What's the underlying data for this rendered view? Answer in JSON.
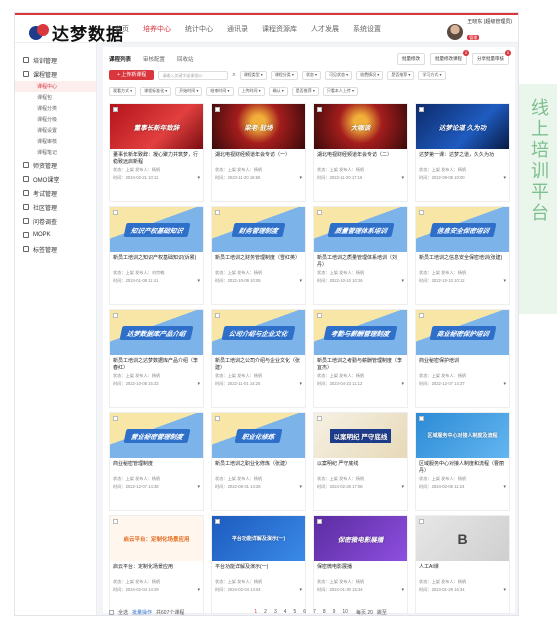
{
  "app": {
    "brand": "达梦数据"
  },
  "topnav": [
    {
      "label": "首页",
      "active": false
    },
    {
      "label": "培养中心",
      "active": true
    },
    {
      "label": "统计中心",
      "active": false
    },
    {
      "label": "通讯录",
      "active": false
    },
    {
      "label": "课程资源库",
      "active": false
    },
    {
      "label": "人才发展",
      "active": false
    },
    {
      "label": "系统设置",
      "active": false
    }
  ],
  "user": {
    "name": "王晓东 (超级管理员)",
    "tag": "管理"
  },
  "sidebar": {
    "items": [
      {
        "label": "培训管理"
      },
      {
        "label": "课程管理"
      },
      {
        "label": "师资管理"
      },
      {
        "label": "OMO课堂"
      },
      {
        "label": "考试管理"
      },
      {
        "label": "社区管理"
      },
      {
        "label": "问卷调查"
      },
      {
        "label": "MOPK"
      },
      {
        "label": "标签管理"
      }
    ],
    "sub": [
      {
        "label": "课程中心",
        "active": true
      },
      {
        "label": "课程包",
        "active": false
      },
      {
        "label": "课程分类",
        "active": false
      },
      {
        "label": "课程分级",
        "active": false
      },
      {
        "label": "课程设置",
        "active": false
      },
      {
        "label": "课程审核",
        "active": false
      },
      {
        "label": "课程笔记",
        "active": false
      }
    ]
  },
  "crumbs": [
    "课程列表",
    "审核配置",
    "回收站"
  ],
  "right_tabs": [
    {
      "label": "批量修改",
      "badge": ""
    },
    {
      "label": "批量修改课程",
      "badge": "0"
    },
    {
      "label": "分享批量审核",
      "badge": "0"
    }
  ],
  "filters1": {
    "add": "+ 上传新课程",
    "search_placeholder": "请输入关键字或课程ID",
    "selects": [
      "课程类型",
      "课程分类",
      "状态",
      "可见状态",
      "收费情况",
      "是否推荐",
      "学习方式"
    ]
  },
  "filters2": {
    "selects": [
      "观看方式",
      "课程标准化",
      "开始时间",
      "结束时间",
      "上传时间",
      "确认",
      "是否推荐",
      "只看本人上传"
    ]
  },
  "cards": [
    {
      "thumb": "t-red",
      "cap": "董事长新年致辞",
      "title": "董事长新年致辞：凝心聚力共筑梦，行稳致远启新程",
      "state": "状态：上架  发布人：杨帆",
      "time": "时间：2024-02-21 10:11"
    },
    {
      "thumb": "t-stage",
      "cap": "梁老·驻场",
      "title": "湖北电视财经频道年会专访（一）",
      "state": "状态：上架  发布人：杨帆",
      "time": "时间：2023-11-20 16:56"
    },
    {
      "thumb": "t-stage",
      "cap": "大咖谈",
      "title": "湖北电视财经频道年会专访（二）",
      "state": "状态：上架  发布人：杨帆",
      "time": "时间：2023-11-20 17:16"
    },
    {
      "thumb": "t-blue",
      "cap": "达梦论道 久为功",
      "title": "达梦第一课：达梦之道，久久为功",
      "state": "状态：上架  发布人：杨帆",
      "time": "时间：2022-09-08 10:00"
    },
    {
      "thumb": "t-edu",
      "cap": "知识产权基础知识",
      "title": "新员工培训之知识产权基础知识(诉累)",
      "state": "状态：上架  发布人：刘宗翰",
      "time": "时间：2024-01-08 11:41"
    },
    {
      "thumb": "t-edu",
      "cap": "财务管理制度",
      "title": "新员工培训之财务管理制度（雪红英）",
      "state": "状态：上架  发布人：杨帆",
      "time": "时间：2022-10-09 10:05"
    },
    {
      "thumb": "t-edu",
      "cap": "质量管理体系培训",
      "title": "新员工培训之质量管理体系培训（刘丹）",
      "state": "状态：上架  发布人：杨帆",
      "time": "时间：2022-10-10 10:26"
    },
    {
      "thumb": "t-edu",
      "cap": "信息安全保密培训",
      "title": "新员工培训之信息安全保密培训(张建)",
      "state": "状态：上架  发布人：杨帆",
      "time": "时间：2022-10-10 10:12"
    },
    {
      "thumb": "t-edu",
      "cap": "达梦数据库产品介绍",
      "title": "新员工培训之达梦数据库产品介绍（李春红）",
      "state": "状态：上架  发布人：杨帆",
      "time": "时间：2022-10-08 15:33"
    },
    {
      "thumb": "t-edu",
      "cap": "公司介绍与企业文化",
      "title": "新员工培训之公司介绍与企业文化（张建）",
      "state": "状态：上架  发布人：杨帆",
      "time": "时间：2022-11-01 14:20"
    },
    {
      "thumb": "t-edu",
      "cap": "考勤与薪酬管理制度",
      "title": "新员工培训之考勤与薪酬管理制度（李宜杰）",
      "state": "状态：上架  发布人：杨帆",
      "time": "时间：2023-04-23 11:12"
    },
    {
      "thumb": "t-edu",
      "cap": "商业秘密保护培训",
      "title": "商业秘密保护培训",
      "state": "状态：上架  发布人：杨帆",
      "time": "时间：2022-12-07 14:37"
    },
    {
      "thumb": "t-edu",
      "cap": "营业秘密管理制度",
      "title": "商业秘密管理制度",
      "state": "状态：上架  发布人：杨帆",
      "time": "时间：2022-12-07 14:38"
    },
    {
      "thumb": "t-edu",
      "cap": "职业化修炼",
      "title": "新员工培训之职业化修炼（张建）",
      "state": "状态：上架  发布人：杨帆",
      "time": "时间：2022-08-31 14:28"
    },
    {
      "thumb": "t-law",
      "cap": "以案明纪 严守底线",
      "title": "以案明纪 严守底线",
      "state": "状态：上架  发布人：杨帆",
      "time": "时间：2024-02-26 17:06"
    },
    {
      "thumb": "t-policy",
      "cap": "区域服务中心对接人制度及流程",
      "title": "区域服务中心对接人制度和流程（曹丽丹）",
      "state": "状态：上架  发布人：杨帆",
      "time": "时间：2024-02-06 11:24"
    },
    {
      "thumb": "t-orange",
      "cap": "启云平台：定制化场景应用",
      "title": "启云平台：定制化场景应用",
      "state": "状态：上架  发布人：杨帆",
      "time": "时间：2024-02-04 14:29"
    },
    {
      "thumb": "t-cal",
      "cap": "平台功能详解及演示(一)",
      "title": "平台功能详解及演示(一)",
      "state": "状态：上架  发布人：杨帆",
      "time": "时间：2024-02-04 14:04"
    },
    {
      "thumb": "t-purple",
      "cap": "保密微电影展播",
      "title": "保密微电影展播",
      "state": "状态：上架  发布人：杨帆",
      "time": "时间：2024-01-30 15:34"
    },
    {
      "thumb": "t-gray",
      "cap": "B",
      "title": "人工AI课",
      "state": "状态：上架  发布人：杨帆",
      "time": "时间：2024-01-29 16:34"
    }
  ],
  "pager": {
    "select_all": "全选",
    "batch": "批量操作",
    "total": "共607个课程",
    "pages": [
      "1",
      "2",
      "3",
      "4",
      "5",
      "6",
      "7",
      "8",
      "9",
      "10"
    ],
    "current": "1",
    "goto": "跳至",
    "size": "每页 20"
  },
  "side_caption": "线上培训平台"
}
